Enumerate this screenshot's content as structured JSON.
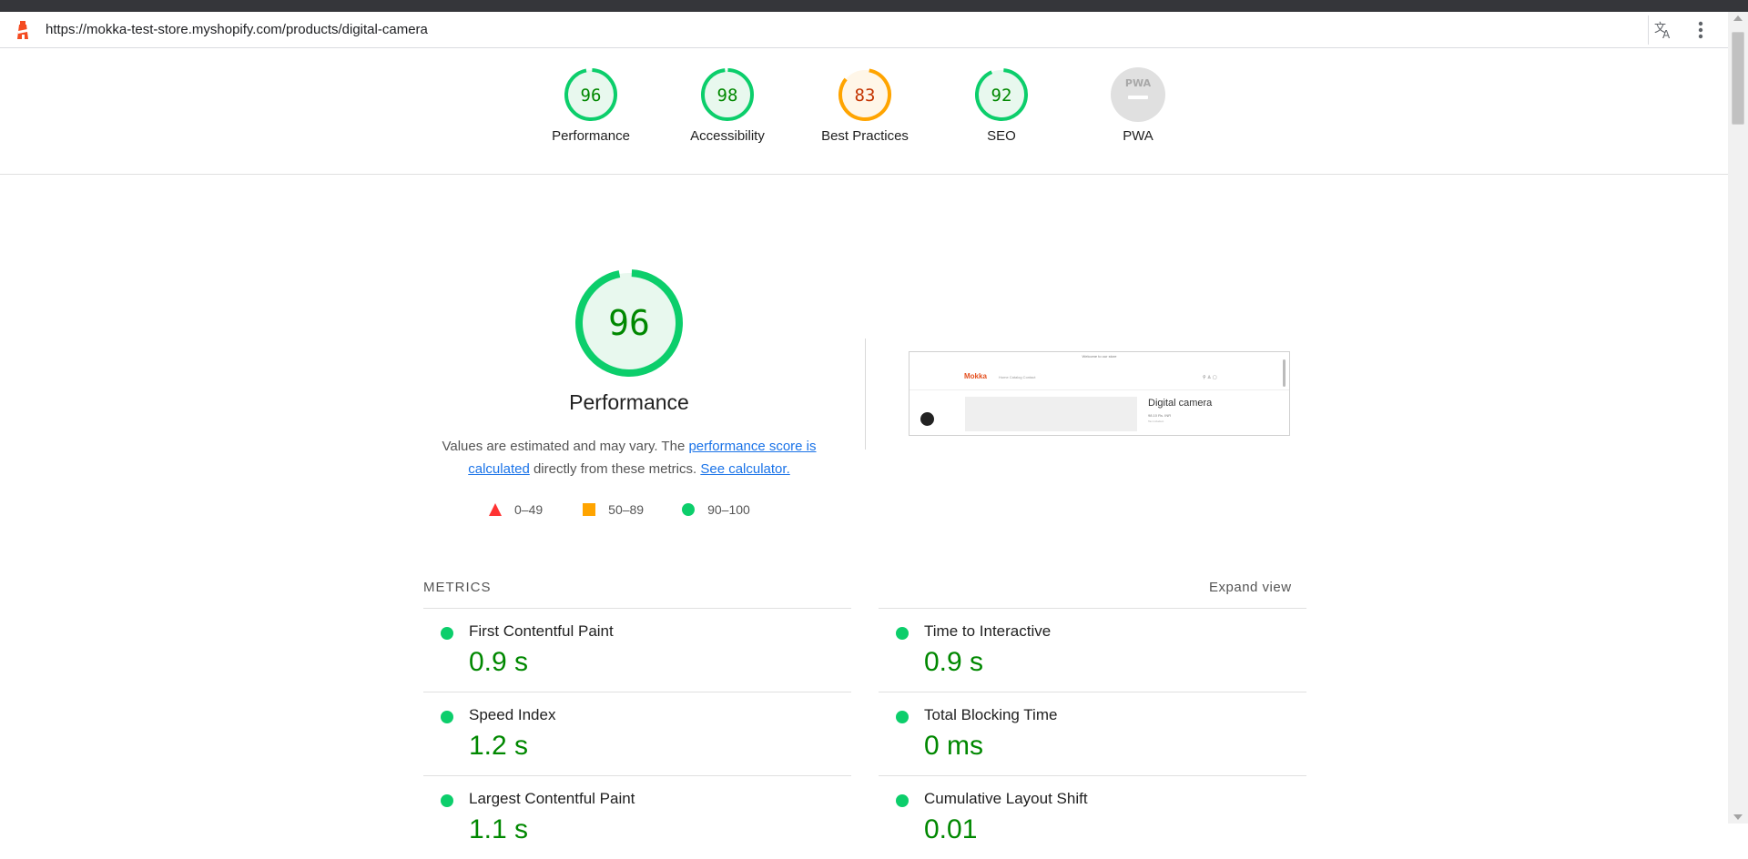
{
  "browser": {
    "url": "https://mokka-test-store.myshopify.com/products/digital-camera"
  },
  "colors": {
    "pass": "#0cce6b",
    "pass_text": "#008800",
    "average": "#ffa400",
    "average_text": "#c33300",
    "fail": "#ff3333",
    "link": "#1a73e8",
    "na": "#e0e0e0"
  },
  "categories": [
    {
      "id": "performance",
      "score": "96",
      "label": "Performance",
      "score_value": 96,
      "rating": "pass"
    },
    {
      "id": "accessibility",
      "score": "98",
      "label": "Accessibility",
      "score_value": 98,
      "rating": "pass"
    },
    {
      "id": "best-practices",
      "score": "83",
      "label": "Best Practices",
      "score_value": 83,
      "rating": "average"
    },
    {
      "id": "seo",
      "score": "92",
      "label": "SEO",
      "score_value": 92,
      "rating": "pass"
    },
    {
      "id": "pwa",
      "score": "PWA",
      "label": "PWA",
      "rating": "na"
    }
  ],
  "performance": {
    "score": "96",
    "score_value": 96,
    "title": "Performance",
    "desc_prefix": "Values are estimated and may vary. The ",
    "desc_link1": "performance score is calculated",
    "desc_middle": " directly from these metrics. ",
    "desc_link2": "See calculator.",
    "legend": [
      {
        "range": "0–49",
        "shape": "triangle",
        "color": "#ff3333"
      },
      {
        "range": "50–89",
        "shape": "square",
        "color": "#ffa400"
      },
      {
        "range": "90–100",
        "shape": "circle",
        "color": "#0cce6b"
      }
    ]
  },
  "thumbnail": {
    "banner": "Welcome to our store",
    "logo": "Mokka",
    "nav": "Home   Catalog   Contact",
    "icons": "⚲  ♙  ▢",
    "product_title": "Digital camera",
    "product_price": "98.10 Rs. INR",
    "product_sub": "Tax included."
  },
  "metrics": {
    "title": "METRICS",
    "expand": "Expand view",
    "items": [
      {
        "name": "First Contentful Paint",
        "value": "0.9 s"
      },
      {
        "name": "Time to Interactive",
        "value": "0.9 s"
      },
      {
        "name": "Speed Index",
        "value": "1.2 s"
      },
      {
        "name": "Total Blocking Time",
        "value": "0 ms"
      },
      {
        "name": "Largest Contentful Paint",
        "value": "1.1 s"
      },
      {
        "name": "Cumulative Layout Shift",
        "value": "0.01"
      }
    ]
  }
}
